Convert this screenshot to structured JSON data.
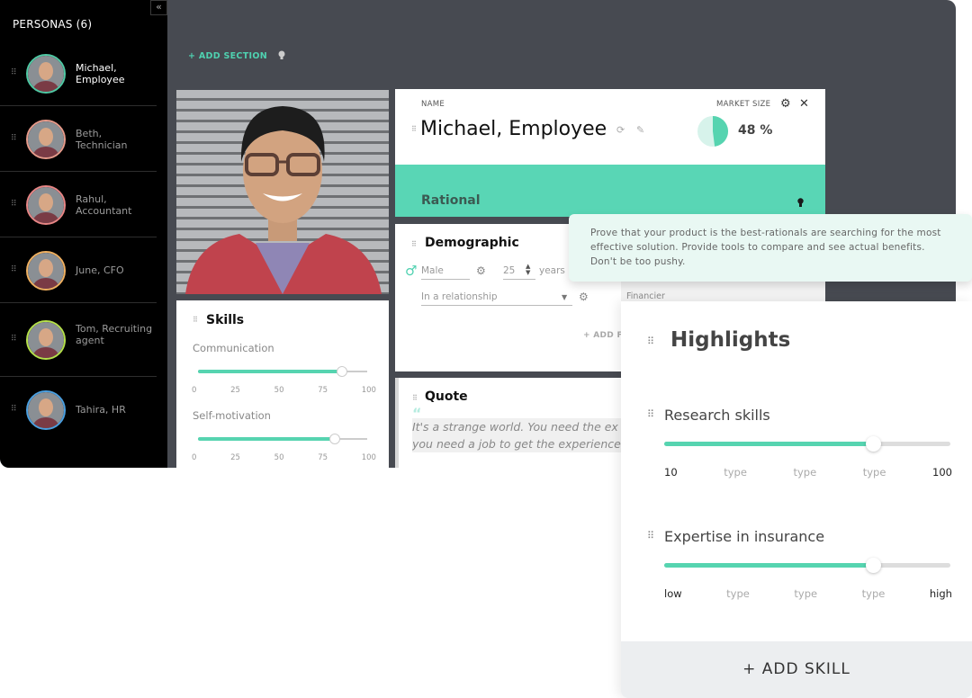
{
  "sidebar": {
    "title": "PERSONAS (6)",
    "collapse_icon": "«",
    "personas": [
      {
        "label": "Michael, Employee",
        "ring_color": "#4fc9a4",
        "active": true
      },
      {
        "label": "Beth, Technician",
        "ring_color": "#e79a8a",
        "active": false
      },
      {
        "label": "Rahul, Accountant",
        "ring_color": "#e88585",
        "active": false
      },
      {
        "label": "June, CFO",
        "ring_color": "#f0b060",
        "active": false
      },
      {
        "label": "Tom, Recruiting agent",
        "ring_color": "#b5e04a",
        "active": false
      },
      {
        "label": "Tahira, HR",
        "ring_color": "#4a9fe0",
        "active": false
      }
    ]
  },
  "toolbar": {
    "add_section_label": "+ ADD SECTION",
    "hint_icon": "lightbulb"
  },
  "name_card": {
    "name_caption": "NAME",
    "name": "Michael, Employee",
    "market_size_caption": "MARKET SIZE",
    "market_size_value": "48 %",
    "market_size_fraction": 0.48
  },
  "rational": {
    "title": "Rational",
    "tooltip": "Prove that your product is the best-rationals are searching for the most effective solution. Provide tools to compare and see actual benefits. Don't be too pushy."
  },
  "demographic": {
    "title": "Demographic",
    "gender": "Male",
    "age": "25",
    "age_unit": "years",
    "relationship": "In a relationship",
    "occupation": "Financier",
    "add_field_label": "+ ADD FI"
  },
  "skills": {
    "title": "Skills",
    "ticks": [
      "0",
      "25",
      "50",
      "75",
      "100"
    ],
    "items": [
      {
        "label": "Communication",
        "value": 85
      },
      {
        "label": "Self-motivation",
        "value": 81
      }
    ]
  },
  "quote": {
    "title": "Quote",
    "text_line1": "It's a strange world. You need the ex",
    "text_line2": "you need a job to get the experience"
  },
  "highlights": {
    "title": "Highlights",
    "items": [
      {
        "label": "Research skills",
        "fraction": 0.73,
        "ticks": [
          "10",
          "type",
          "type",
          "type",
          "100"
        ]
      },
      {
        "label": "Expertise in insurance",
        "fraction": 0.73,
        "ticks": [
          "low",
          "type",
          "type",
          "type",
          "high"
        ]
      }
    ],
    "add_skill_label": "+  ADD SKILL"
  },
  "colors": {
    "accent": "#56d4b0",
    "window_bg": "#474a51",
    "sidebar_bg": "#000000",
    "tooltip_bg": "#e9f8f3"
  }
}
